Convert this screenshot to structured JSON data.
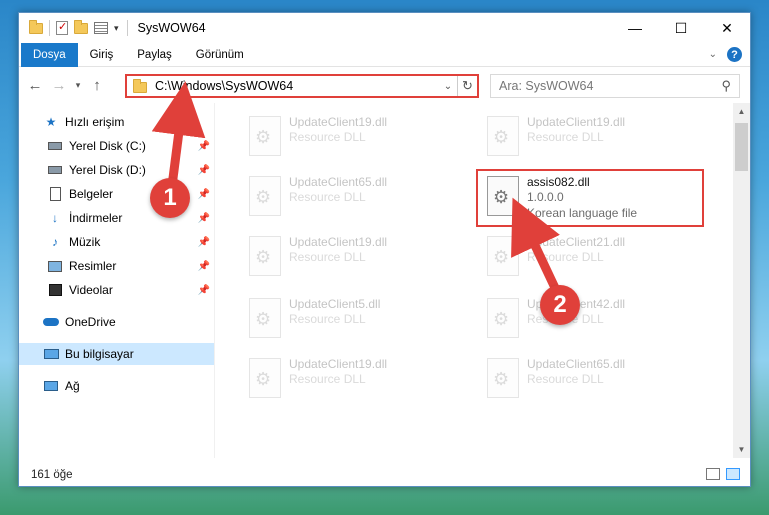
{
  "window": {
    "title": "SysWOW64"
  },
  "ribbon": {
    "tabs": [
      "Dosya",
      "Giriş",
      "Paylaş",
      "Görünüm"
    ]
  },
  "address": {
    "path": "C:\\Windows\\SysWOW64",
    "search_placeholder": "Ara: SysWOW64"
  },
  "nav": {
    "items": [
      {
        "label": "Hızlı erişim",
        "icon": "star-icon",
        "pinned": false
      },
      {
        "label": "Yerel Disk (C:)",
        "icon": "drive-icon",
        "pinned": true
      },
      {
        "label": "Yerel Disk (D:)",
        "icon": "drive-icon",
        "pinned": true
      },
      {
        "label": "Belgeler",
        "icon": "documents-icon",
        "pinned": true
      },
      {
        "label": "İndirmeler",
        "icon": "download-icon",
        "pinned": true
      },
      {
        "label": "Müzik",
        "icon": "music-icon",
        "pinned": true
      },
      {
        "label": "Resimler",
        "icon": "pictures-icon",
        "pinned": true
      },
      {
        "label": "Videolar",
        "icon": "videos-icon",
        "pinned": true
      },
      {
        "label": "OneDrive",
        "icon": "cloud-icon",
        "pinned": false
      },
      {
        "label": "Bu bilgisayar",
        "icon": "computer-icon",
        "pinned": false
      },
      {
        "label": "Ağ",
        "icon": "network-icon",
        "pinned": false
      }
    ]
  },
  "files": [
    {
      "name": "UpdateClient19.dll",
      "line2": "Resource DLL",
      "line3": ""
    },
    {
      "name": "UpdateClient19.dll",
      "line2": "Resource DLL",
      "line3": ""
    },
    {
      "name": "UpdateClient65.dll",
      "line2": "Resource DLL",
      "line3": ""
    },
    {
      "name": "assis082.dll",
      "line2": "1.0.0.0",
      "line3": "Korean language file"
    },
    {
      "name": "UpdateClient19.dll",
      "line2": "Resource DLL",
      "line3": ""
    },
    {
      "name": "UpdateClient21.dll",
      "line2": "Resource DLL",
      "line3": ""
    },
    {
      "name": "UpdateClient5.dll",
      "line2": "Resource DLL",
      "line3": ""
    },
    {
      "name": "UpdateClient42.dll",
      "line2": "Resource DLL",
      "line3": ""
    },
    {
      "name": "UpdateClient19.dll",
      "line2": "Resource DLL",
      "line3": ""
    },
    {
      "name": "UpdateClient65.dll",
      "line2": "Resource DLL",
      "line3": ""
    }
  ],
  "status": {
    "count": "161 öğe"
  },
  "annotations": {
    "marker1": "1",
    "marker2": "2"
  },
  "colors": {
    "accent": "#1979ca",
    "highlight": "#e0403a",
    "selected": "#cce8ff"
  }
}
